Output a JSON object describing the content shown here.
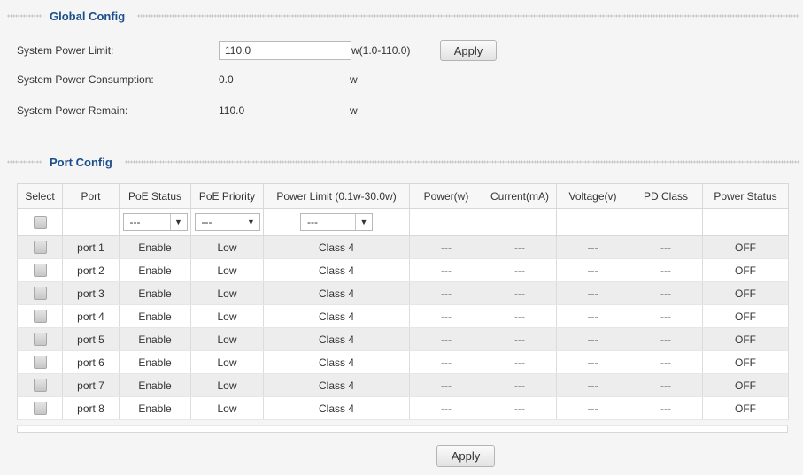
{
  "global": {
    "title": "Global Config",
    "power_limit_label": "System Power Limit:",
    "power_limit_value": "110.0",
    "power_limit_range": "w(1.0-110.0)",
    "apply_label": "Apply",
    "consumption_label": "System Power Consumption:",
    "consumption_value": "0.0",
    "consumption_unit": "w",
    "remain_label": "System Power Remain:",
    "remain_value": "110.0",
    "remain_unit": "w"
  },
  "ports": {
    "title": "Port Config",
    "headers": [
      "Select",
      "Port",
      "PoE Status",
      "PoE Priority",
      "Power Limit (0.1w-30.0w)",
      "Power(w)",
      "Current(mA)",
      "Voltage(v)",
      "PD Class",
      "Power Status"
    ],
    "filter": {
      "status": "---",
      "priority": "---",
      "limit": "---"
    },
    "rows": [
      {
        "port": "port 1",
        "status": "Enable",
        "priority": "Low",
        "limit": "Class 4",
        "power": "---",
        "current": "---",
        "voltage": "---",
        "pd_class": "---",
        "power_status": "OFF"
      },
      {
        "port": "port 2",
        "status": "Enable",
        "priority": "Low",
        "limit": "Class 4",
        "power": "---",
        "current": "---",
        "voltage": "---",
        "pd_class": "---",
        "power_status": "OFF"
      },
      {
        "port": "port 3",
        "status": "Enable",
        "priority": "Low",
        "limit": "Class 4",
        "power": "---",
        "current": "---",
        "voltage": "---",
        "pd_class": "---",
        "power_status": "OFF"
      },
      {
        "port": "port 4",
        "status": "Enable",
        "priority": "Low",
        "limit": "Class 4",
        "power": "---",
        "current": "---",
        "voltage": "---",
        "pd_class": "---",
        "power_status": "OFF"
      },
      {
        "port": "port 5",
        "status": "Enable",
        "priority": "Low",
        "limit": "Class 4",
        "power": "---",
        "current": "---",
        "voltage": "---",
        "pd_class": "---",
        "power_status": "OFF"
      },
      {
        "port": "port 6",
        "status": "Enable",
        "priority": "Low",
        "limit": "Class 4",
        "power": "---",
        "current": "---",
        "voltage": "---",
        "pd_class": "---",
        "power_status": "OFF"
      },
      {
        "port": "port 7",
        "status": "Enable",
        "priority": "Low",
        "limit": "Class 4",
        "power": "---",
        "current": "---",
        "voltage": "---",
        "pd_class": "---",
        "power_status": "OFF"
      },
      {
        "port": "port 8",
        "status": "Enable",
        "priority": "Low",
        "limit": "Class 4",
        "power": "---",
        "current": "---",
        "voltage": "---",
        "pd_class": "---",
        "power_status": "OFF"
      }
    ],
    "apply_label": "Apply"
  },
  "colors": {
    "section_title": "#1a4f8b",
    "odd_row": "#ededed",
    "even_row": "#ffffff"
  },
  "icons": {
    "dropdown_arrow": "caret-down-icon",
    "checkbox": "checkbox-icon"
  }
}
